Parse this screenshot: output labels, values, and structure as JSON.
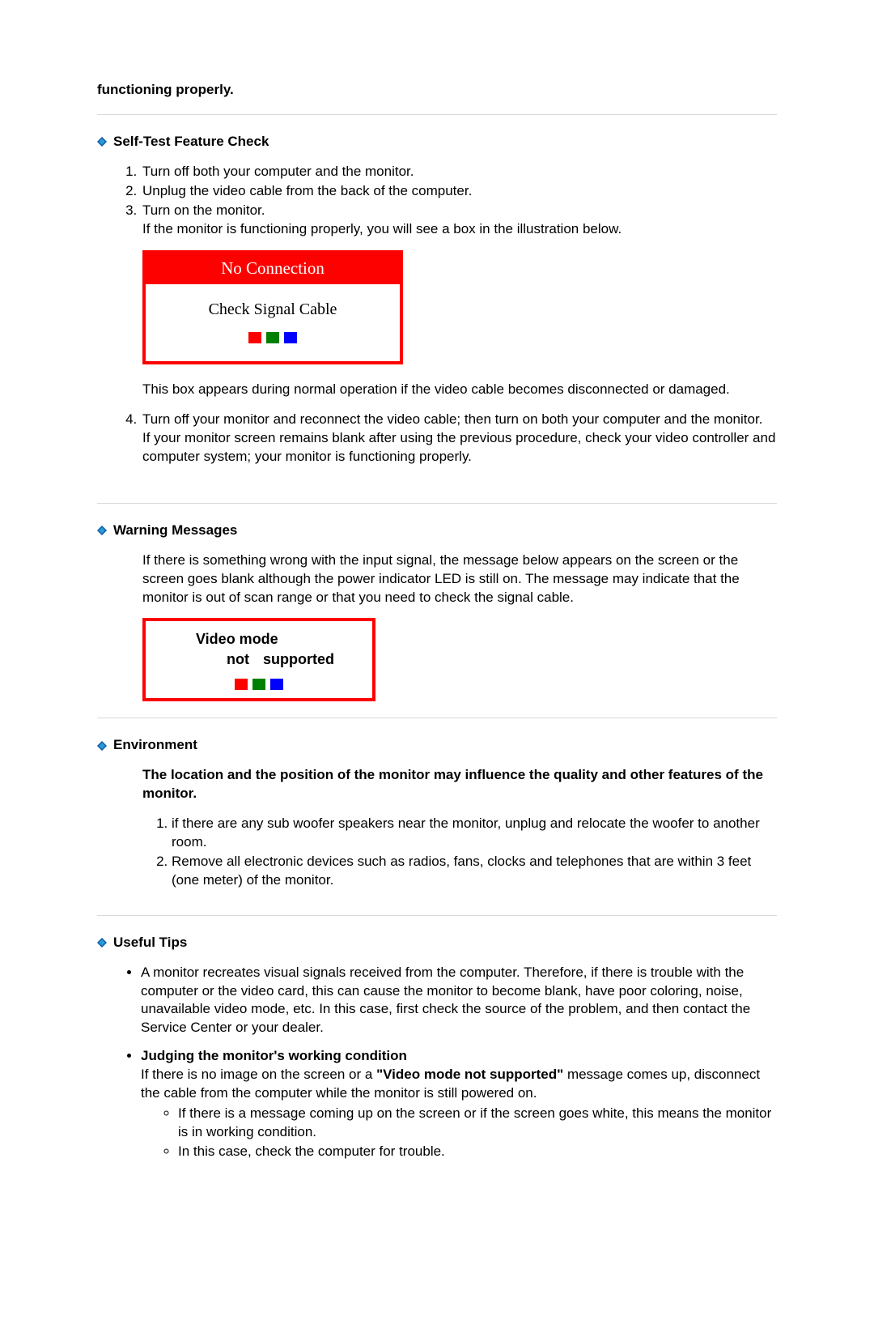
{
  "intro": "functioning properly.",
  "sections": {
    "selfTest": {
      "title": "Self-Test Feature Check",
      "steps": [
        "Turn off both your computer and the monitor.",
        "Unplug the video cable from the back of the computer.",
        "Turn on the monitor."
      ],
      "step3_note": "If the monitor is functioning properly, you will see a box in the illustration below.",
      "osd": {
        "title": "No Connection",
        "line1": "Check Signal Cable"
      },
      "afterBox": "This box appears during normal operation if the video cable becomes disconnected or damaged.",
      "step4": "Turn off your monitor and reconnect the video cable; then turn on both your computer and the monitor.",
      "step4_note": "If your monitor screen remains blank after using the previous procedure, check your video controller and computer system; your monitor is functioning properly."
    },
    "warning": {
      "title": "Warning Messages",
      "para": "If there is something wrong with the input signal, the message below appears on the screen or the screen goes blank although the power indicator LED is still on. The message may indicate that the monitor is out of scan range or that you need to check the signal cable.",
      "osd": {
        "line1": "Video mode",
        "line2": "not  supported"
      }
    },
    "environment": {
      "title": "Environment",
      "intro": "The location and the position of the monitor may influence the quality and other features of the monitor.",
      "items": [
        "if there are any sub woofer speakers near the monitor, unplug and relocate the woofer to another room.",
        "Remove all electronic devices such as radios, fans, clocks and telephones that are within 3 feet (one meter) of the monitor."
      ]
    },
    "tips": {
      "title": "Useful Tips",
      "bullet1": "A monitor recreates visual signals received from the computer. Therefore, if there is trouble with the computer or the video card, this can cause the monitor to become blank, have poor coloring, noise, unavailable video mode, etc. In this case, first check the source of the problem, and then contact the Service Center or your dealer.",
      "judging": {
        "heading": "Judging the monitor's working condition",
        "line_pre": "If there is no image on the screen or a ",
        "line_bold": "\"Video mode not supported\"",
        "line_post": " message comes up, disconnect the cable from the computer while the monitor is still powered on.",
        "sub": [
          "If there is a message coming up on the screen or if the screen goes white, this means the monitor is in working condition.",
          "In this case, check the computer for trouble."
        ]
      }
    }
  }
}
